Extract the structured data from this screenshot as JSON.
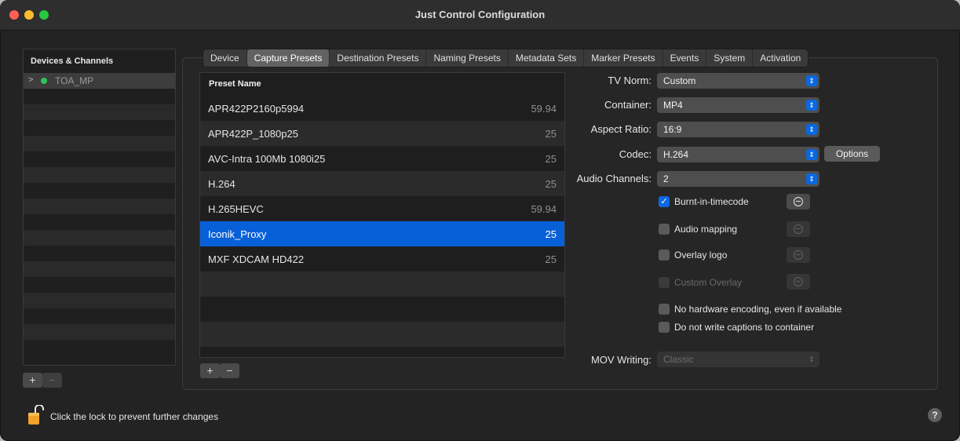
{
  "window": {
    "title": "Just Control Configuration",
    "traffic_lights": {
      "close": "#fe5f57",
      "minimize": "#febc2e",
      "zoom": "#28c840"
    }
  },
  "sidebar": {
    "header": "Devices & Channels",
    "devices": [
      {
        "chevron": ">",
        "name": "TOA_MP",
        "status_color": "#2fc45a"
      }
    ],
    "add_label": "+",
    "remove_label": "−"
  },
  "tabs": [
    {
      "label": "Device"
    },
    {
      "label": "Capture Presets",
      "active": true
    },
    {
      "label": "Destination Presets"
    },
    {
      "label": "Naming Presets"
    },
    {
      "label": "Metadata Sets"
    },
    {
      "label": "Marker Presets"
    },
    {
      "label": "Events"
    },
    {
      "label": "System"
    },
    {
      "label": "Activation"
    }
  ],
  "preset_table": {
    "header": "Preset Name",
    "rows": [
      {
        "name": "APR422P2160p5994",
        "rate": "59.94"
      },
      {
        "name": "APR422P_1080p25",
        "rate": "25"
      },
      {
        "name": "AVC-Intra 100Mb 1080i25",
        "rate": "25"
      },
      {
        "name": "H.264",
        "rate": "25"
      },
      {
        "name": "H.265HEVC",
        "rate": "59.94"
      },
      {
        "name": "Iconik_Proxy",
        "rate": "25",
        "selected": true
      },
      {
        "name": "MXF XDCAM HD422",
        "rate": "25"
      }
    ],
    "add_label": "+",
    "remove_label": "−"
  },
  "form": {
    "tv_norm": {
      "label": "TV Norm:",
      "value": "Custom"
    },
    "container": {
      "label": "Container:",
      "value": "MP4"
    },
    "aspect_ratio": {
      "label": "Aspect Ratio:",
      "value": "16:9"
    },
    "codec": {
      "label": "Codec:",
      "value": "H.264",
      "options_label": "Options"
    },
    "audio_channels": {
      "label": "Audio Channels:",
      "value": "2"
    },
    "checkboxes": {
      "burnt_in_timecode": {
        "label": "Burnt-in-timecode",
        "checked": true
      },
      "audio_mapping": {
        "label": "Audio mapping",
        "checked": false
      },
      "overlay_logo": {
        "label": "Overlay logo",
        "checked": false
      },
      "custom_overlay": {
        "label": "Custom Overlay",
        "checked": false,
        "disabled": true
      },
      "no_hw_encoding": {
        "label": "No hardware encoding, even if available",
        "checked": false
      },
      "no_captions": {
        "label": "Do not write captions to container",
        "checked": false
      }
    },
    "mov_writing": {
      "label": "MOV Writing:",
      "value": "Classic",
      "disabled": true
    }
  },
  "footer": {
    "lock_text": "Click the lock to prevent further changes",
    "help_label": "?"
  },
  "accent_color": "#0a68e0"
}
